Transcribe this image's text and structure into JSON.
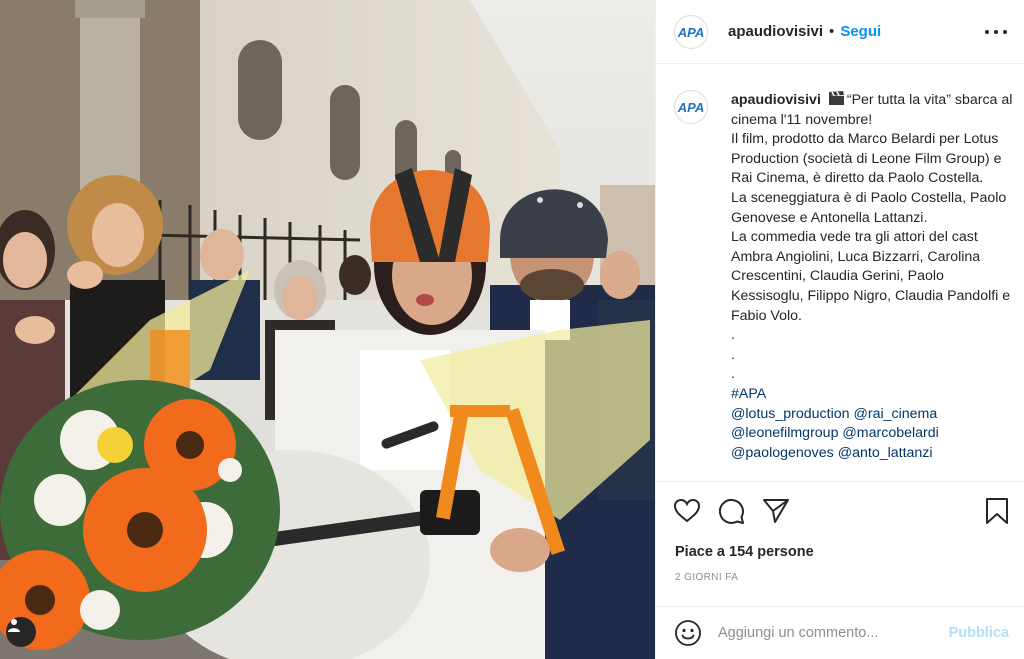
{
  "account": {
    "username": "apaudiovisivi",
    "avatar_text": "APA",
    "follow_label": "Segui",
    "separator": "•"
  },
  "caption": {
    "username": "apaudiovisivi",
    "icon": "clapper-board-emoji",
    "lines": [
      "“Per tutta la vita” sbarca al cinema l'11 novembre!",
      "Il film, prodotto da Marco Belardi per Lotus Production (società di Leone Film Group) e Rai Cinema, è diretto da Paolo Costella.",
      "La sceneggiatura è di Paolo Costella, Paolo Genovese e Antonella Lattanzi.",
      "La commedia vede tra gli attori del cast Ambra Angiolini, Luca Bizzarri, Carolina Crescentini, Claudia Gerini, Paolo Kessisoglu, Filippo Nigro, Claudia Pandolfi e Fabio Volo.",
      ".",
      ".",
      "."
    ],
    "hashtag": "#APA",
    "mention_lines": [
      "@lotus_production @rai_cinema",
      "@leonefilmgroup @marcobelardi",
      "@paologenoves @anto_lattanzi"
    ]
  },
  "actions": {
    "like": "heart-icon",
    "comment": "comment-bubble-icon",
    "share": "paper-plane-icon",
    "save": "bookmark-icon"
  },
  "likes_text": "Piace a 154 persone",
  "time_text": "2 GIORNI FA",
  "comment": {
    "placeholder": "Aggiungi un commento...",
    "publish_label": "Pubblica",
    "emoji_icon": "smiley-icon"
  },
  "photo": {
    "user_tag_icon": "user-tag-icon"
  },
  "colors": {
    "accent": "#0095f6",
    "link": "#00376b",
    "publish_disabled": "#b2dffc",
    "muted": "#8e8e8e",
    "text": "#262626",
    "logo_blue": "#1e73be"
  }
}
